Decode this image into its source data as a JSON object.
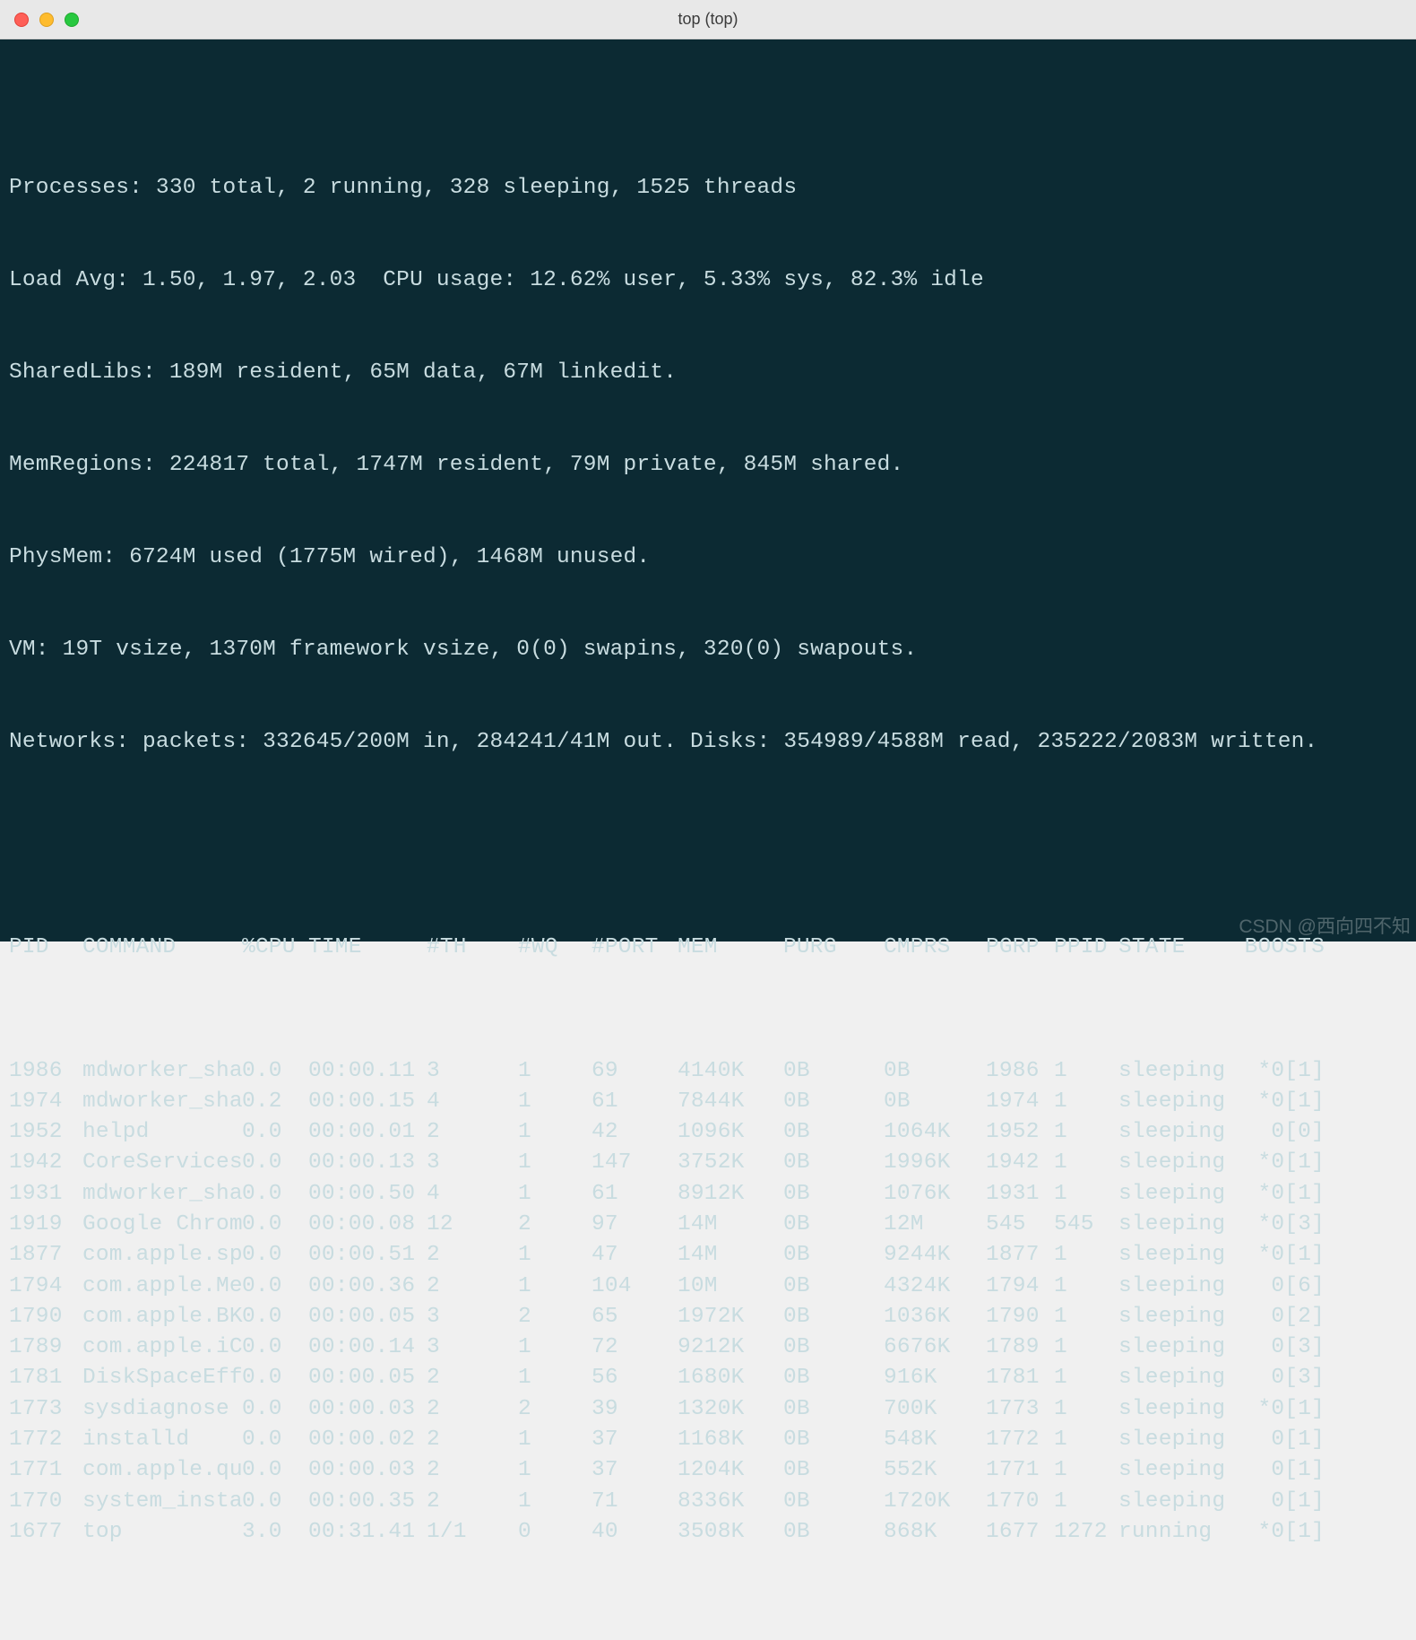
{
  "window": {
    "title": "top (top)"
  },
  "header": {
    "processes": "Processes: 330 total, 2 running, 328 sleeping, 1525 threads",
    "load_cpu": "Load Avg: 1.50, 1.97, 2.03  CPU usage: 12.62% user, 5.33% sys, 82.3% idle",
    "sharedlibs": "SharedLibs: 189M resident, 65M data, 67M linkedit.",
    "memregions": "MemRegions: 224817 total, 1747M resident, 79M private, 845M shared.",
    "physmem": "PhysMem: 6724M used (1775M wired), 1468M unused.",
    "vm": "VM: 19T vsize, 1370M framework vsize, 0(0) swapins, 320(0) swapouts.",
    "net_disk": "Networks: packets: 332645/200M in, 284241/41M out. Disks: 354989/4588M read, 235222/2083M written."
  },
  "columns": {
    "pid": "PID",
    "command": "COMMAND",
    "cpu": "%CPU",
    "time": "TIME",
    "th": "#TH",
    "wq": "#WQ",
    "port": "#PORT",
    "mem": "MEM",
    "purg": "PURG",
    "cmprs": "CMPRS",
    "pgrp": "PGRP",
    "ppid": "PPID",
    "state": "STATE",
    "boosts": "BOOSTS"
  },
  "rows": [
    {
      "pid": "1986",
      "command": "mdworker_sha",
      "cpu": "0.0",
      "time": "00:00.11",
      "th": "3",
      "wq": "1",
      "port": "69",
      "mem": "4140K",
      "purg": "0B",
      "cmprs": "0B",
      "pgrp": "1986",
      "ppid": "1",
      "state": "sleeping",
      "boosts": "*0[1]"
    },
    {
      "pid": "1974",
      "command": "mdworker_sha",
      "cpu": "0.2",
      "time": "00:00.15",
      "th": "4",
      "wq": "1",
      "port": "61",
      "mem": "7844K",
      "purg": "0B",
      "cmprs": "0B",
      "pgrp": "1974",
      "ppid": "1",
      "state": "sleeping",
      "boosts": "*0[1]"
    },
    {
      "pid": "1952",
      "command": "helpd",
      "cpu": "0.0",
      "time": "00:00.01",
      "th": "2",
      "wq": "1",
      "port": "42",
      "mem": "1096K",
      "purg": "0B",
      "cmprs": "1064K",
      "pgrp": "1952",
      "ppid": "1",
      "state": "sleeping",
      "boosts": "0[0]"
    },
    {
      "pid": "1942",
      "command": "CoreServices",
      "cpu": "0.0",
      "time": "00:00.13",
      "th": "3",
      "wq": "1",
      "port": "147",
      "mem": "3752K",
      "purg": "0B",
      "cmprs": "1996K",
      "pgrp": "1942",
      "ppid": "1",
      "state": "sleeping",
      "boosts": "*0[1]"
    },
    {
      "pid": "1931",
      "command": "mdworker_sha",
      "cpu": "0.0",
      "time": "00:00.50",
      "th": "4",
      "wq": "1",
      "port": "61",
      "mem": "8912K",
      "purg": "0B",
      "cmprs": "1076K",
      "pgrp": "1931",
      "ppid": "1",
      "state": "sleeping",
      "boosts": "*0[1]"
    },
    {
      "pid": "1919",
      "command": "Google Chrom",
      "cpu": "0.0",
      "time": "00:00.08",
      "th": "12",
      "wq": "2",
      "port": "97",
      "mem": "14M",
      "purg": "0B",
      "cmprs": "12M",
      "pgrp": "545",
      "ppid": "545",
      "state": "sleeping",
      "boosts": "*0[3]"
    },
    {
      "pid": "1877",
      "command": "com.apple.sp",
      "cpu": "0.0",
      "time": "00:00.51",
      "th": "2",
      "wq": "1",
      "port": "47",
      "mem": "14M",
      "purg": "0B",
      "cmprs": "9244K",
      "pgrp": "1877",
      "ppid": "1",
      "state": "sleeping",
      "boosts": "*0[1]"
    },
    {
      "pid": "1794",
      "command": "com.apple.Me",
      "cpu": "0.0",
      "time": "00:00.36",
      "th": "2",
      "wq": "1",
      "port": "104",
      "mem": "10M",
      "purg": "0B",
      "cmprs": "4324K",
      "pgrp": "1794",
      "ppid": "1",
      "state": "sleeping",
      "boosts": "0[6]"
    },
    {
      "pid": "1790",
      "command": "com.apple.BK",
      "cpu": "0.0",
      "time": "00:00.05",
      "th": "3",
      "wq": "2",
      "port": "65",
      "mem": "1972K",
      "purg": "0B",
      "cmprs": "1036K",
      "pgrp": "1790",
      "ppid": "1",
      "state": "sleeping",
      "boosts": "0[2]"
    },
    {
      "pid": "1789",
      "command": "com.apple.iC",
      "cpu": "0.0",
      "time": "00:00.14",
      "th": "3",
      "wq": "1",
      "port": "72",
      "mem": "9212K",
      "purg": "0B",
      "cmprs": "6676K",
      "pgrp": "1789",
      "ppid": "1",
      "state": "sleeping",
      "boosts": "0[3]"
    },
    {
      "pid": "1781",
      "command": "DiskSpaceEff",
      "cpu": "0.0",
      "time": "00:00.05",
      "th": "2",
      "wq": "1",
      "port": "56",
      "mem": "1680K",
      "purg": "0B",
      "cmprs": "916K",
      "pgrp": "1781",
      "ppid": "1",
      "state": "sleeping",
      "boosts": "0[3]"
    },
    {
      "pid": "1773",
      "command": "sysdiagnose",
      "cpu": "0.0",
      "time": "00:00.03",
      "th": "2",
      "wq": "2",
      "port": "39",
      "mem": "1320K",
      "purg": "0B",
      "cmprs": "700K",
      "pgrp": "1773",
      "ppid": "1",
      "state": "sleeping",
      "boosts": "*0[1]"
    },
    {
      "pid": "1772",
      "command": "installd",
      "cpu": "0.0",
      "time": "00:00.02",
      "th": "2",
      "wq": "1",
      "port": "37",
      "mem": "1168K",
      "purg": "0B",
      "cmprs": "548K",
      "pgrp": "1772",
      "ppid": "1",
      "state": "sleeping",
      "boosts": "0[1]"
    },
    {
      "pid": "1771",
      "command": "com.apple.qu",
      "cpu": "0.0",
      "time": "00:00.03",
      "th": "2",
      "wq": "1",
      "port": "37",
      "mem": "1204K",
      "purg": "0B",
      "cmprs": "552K",
      "pgrp": "1771",
      "ppid": "1",
      "state": "sleeping",
      "boosts": "0[1]"
    },
    {
      "pid": "1770",
      "command": "system_insta",
      "cpu": "0.0",
      "time": "00:00.35",
      "th": "2",
      "wq": "1",
      "port": "71",
      "mem": "8336K",
      "purg": "0B",
      "cmprs": "1720K",
      "pgrp": "1770",
      "ppid": "1",
      "state": "sleeping",
      "boosts": "0[1]"
    },
    {
      "pid": "1677",
      "command": "top",
      "cpu": "3.0",
      "time": "00:31.41",
      "th": "1/1",
      "wq": "0",
      "port": "40",
      "mem": "3508K",
      "purg": "0B",
      "cmprs": "868K",
      "pgrp": "1677",
      "ppid": "1272",
      "state": "running",
      "boosts": "*0[1]"
    }
  ],
  "watermark": "CSDN @西向四不知"
}
